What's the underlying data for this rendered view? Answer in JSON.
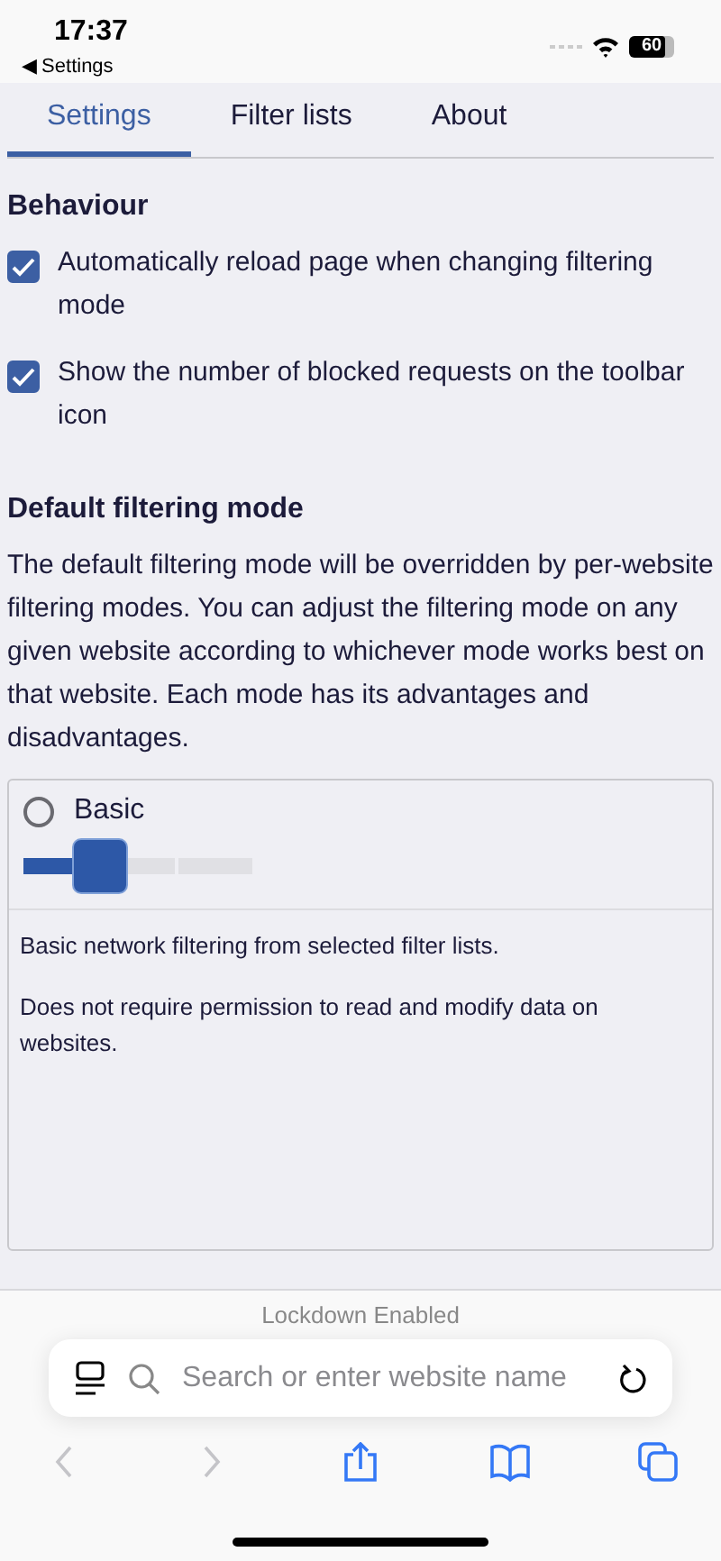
{
  "status_bar": {
    "time": "17:37",
    "back_label": "◀ Settings",
    "battery": "60"
  },
  "tabs": [
    {
      "label": "Settings",
      "selected": true
    },
    {
      "label": "Filter lists",
      "selected": false
    },
    {
      "label": "About",
      "selected": false
    }
  ],
  "behaviour": {
    "heading": "Behaviour",
    "options": [
      {
        "label": "Automatically reload page when changing filtering mode",
        "checked": true
      },
      {
        "label": "Show the number of blocked requests on the toolbar icon",
        "checked": true
      }
    ]
  },
  "default_mode": {
    "heading": "Default filtering mode",
    "description": "The default filtering mode will be overridden by per-website filtering modes. You can adjust the filtering mode on any given website according to whichever mode works best on that website. Each mode has its advantages and disadvantages.",
    "mode": {
      "label": "Basic",
      "selected": false,
      "level": 0.33,
      "details": [
        "Basic network filtering from selected filter lists.",
        "Does not require permission to read and modify data on websites."
      ]
    }
  },
  "browser": {
    "lockdown": "Lockdown Enabled",
    "search_placeholder": "Search or enter website name",
    "toolbar": [
      {
        "kind": "back",
        "disabled": true
      },
      {
        "kind": "forward",
        "disabled": true
      },
      {
        "kind": "share",
        "disabled": false
      },
      {
        "kind": "bookmarks",
        "disabled": false
      },
      {
        "kind": "tabs",
        "disabled": false
      }
    ]
  }
}
